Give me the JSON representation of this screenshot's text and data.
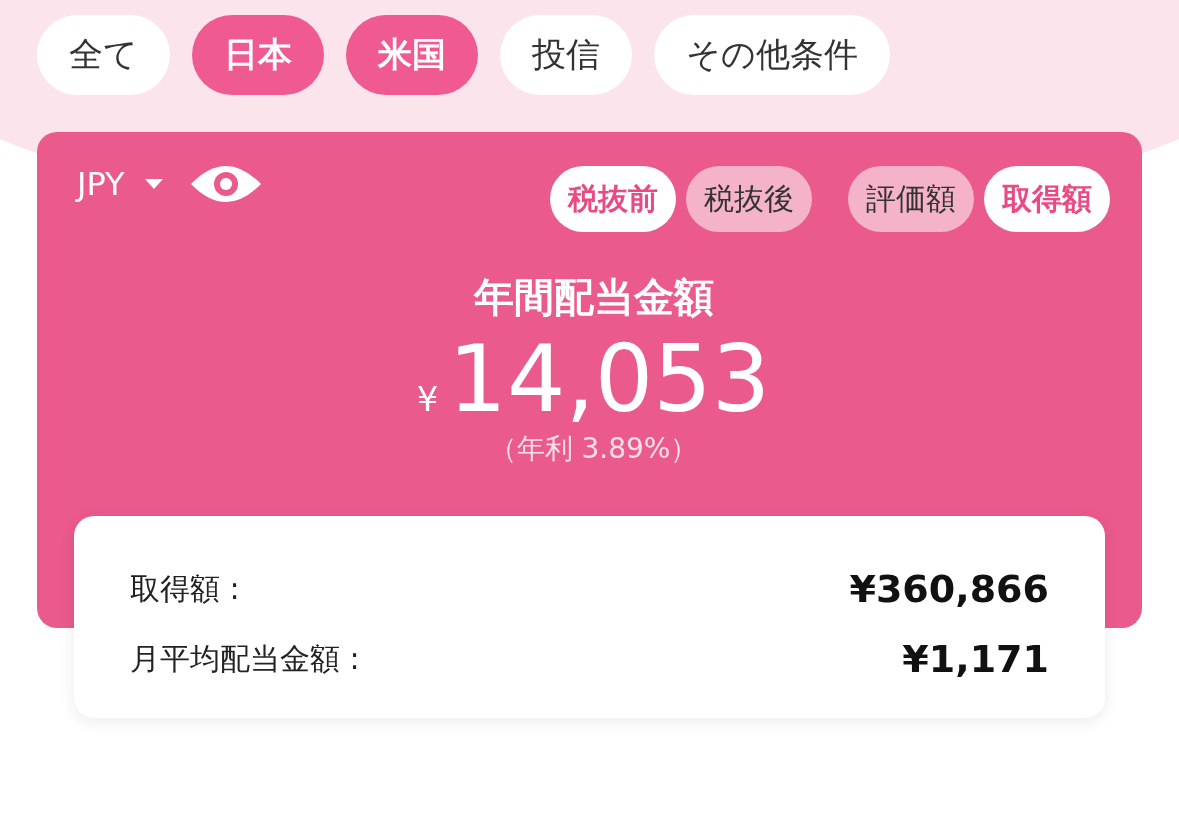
{
  "filters": [
    {
      "label": "全て",
      "selected": false
    },
    {
      "label": "日本",
      "selected": true
    },
    {
      "label": "米国",
      "selected": true
    },
    {
      "label": "投信",
      "selected": false
    },
    {
      "label": "その他条件",
      "selected": false
    }
  ],
  "currency": {
    "label": "JPY"
  },
  "tax_toggle": [
    {
      "label": "税抜前",
      "selected": true
    },
    {
      "label": "税抜後",
      "selected": false
    }
  ],
  "basis_toggle": [
    {
      "label": "評価額",
      "selected": false
    },
    {
      "label": "取得額",
      "selected": true
    }
  ],
  "summary": {
    "title": "年間配当金額",
    "currency_symbol": "¥",
    "amount": "14,053",
    "yield": "（年利 3.89%）"
  },
  "details": [
    {
      "label": "取得額 :",
      "value": "¥360,866"
    },
    {
      "label": "月平均配当金額 :",
      "value": "¥1,171"
    }
  ]
}
